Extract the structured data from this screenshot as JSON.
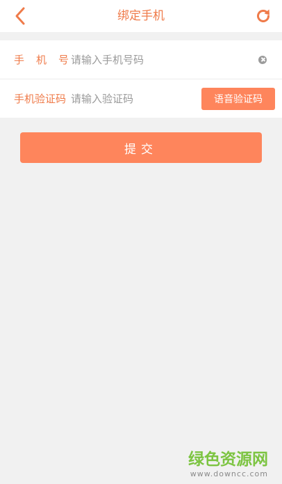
{
  "header": {
    "title": "绑定手机",
    "back_icon": "chevron-left-icon",
    "refresh_icon": "refresh-icon"
  },
  "form": {
    "phone": {
      "label": "手机号",
      "value": "",
      "placeholder": "请输入手机号码",
      "clear_icon": "clear-icon"
    },
    "code": {
      "label": "手机验证码",
      "value": "",
      "placeholder": "请输入验证码",
      "voice_button_label": "语音验证码"
    }
  },
  "submit": {
    "label": "提交"
  },
  "watermark": {
    "site_name": "绿色资源网",
    "url": "www.downcc.com"
  },
  "colors": {
    "accent": "#ef7b4a",
    "button": "#fe855c",
    "background": "#f1f1f1",
    "watermark_green": "#7cc441"
  }
}
